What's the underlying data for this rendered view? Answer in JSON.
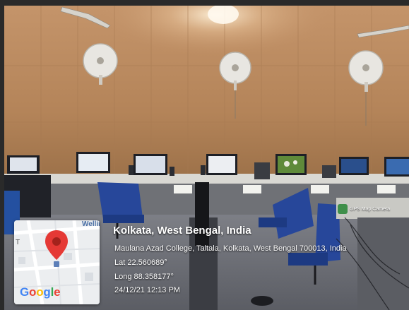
{
  "location": {
    "place": "Kolkata, West Bengal, India",
    "address": "Maulana Azad College, Taltala, Kolkata, West Bengal 700013, India",
    "lat": "Lat 22.560689°",
    "long": "Long 88.358177°",
    "datetime": "24/12/21 12:13 PM"
  },
  "map_thumbnail": {
    "street_label": "Wellin",
    "edge_label": "T",
    "logo_text": "Google",
    "logo_letters": [
      {
        "ch": "G",
        "color": "#4285F4"
      },
      {
        "ch": "o",
        "color": "#EA4335"
      },
      {
        "ch": "o",
        "color": "#FBBC05"
      },
      {
        "ch": "g",
        "color": "#4285F4"
      },
      {
        "ch": "l",
        "color": "#34A853"
      },
      {
        "ch": "e",
        "color": "#EA4335"
      }
    ],
    "pin_color": "#E53935",
    "pin_icon": "map-pin-icon"
  },
  "badge": {
    "label": "GPS Map Camera",
    "icon": "gps-map-camera-icon"
  }
}
